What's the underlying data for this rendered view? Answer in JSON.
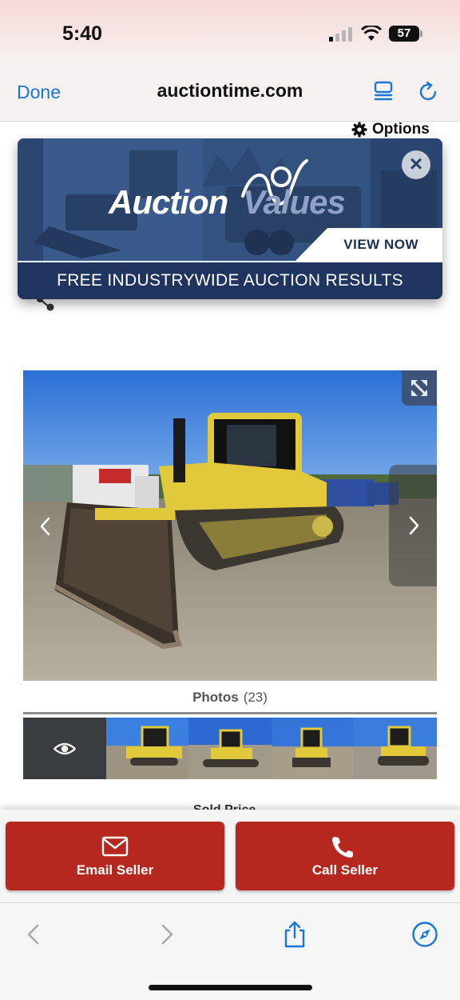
{
  "status_bar": {
    "time": "5:40",
    "battery": "57"
  },
  "browser": {
    "done_label": "Done",
    "host": "auctiontime.com"
  },
  "page": {
    "options_label": "Options",
    "ad": {
      "logo_part1": "Auction",
      "logo_part2": "Values",
      "cta": "VIEW NOW",
      "banner": "FREE INDUSTRYWIDE AUCTION RESULTS"
    },
    "photos": {
      "label": "Photos",
      "count": "(23)"
    },
    "peek_text": "Sold Price"
  },
  "actions": {
    "email_label": "Email Seller",
    "call_label": "Call Seller"
  },
  "colors": {
    "accent": "#1878d8",
    "cta": "#b5271f",
    "ad_navy": "#1f345e"
  },
  "icons": [
    "gear-icon",
    "close-icon",
    "expand-icon",
    "chevron-left-icon",
    "chevron-right-icon",
    "eye-icon",
    "mail-icon",
    "phone-icon",
    "back-icon",
    "forward-icon",
    "share-icon",
    "compass-icon",
    "reader-icon",
    "reload-icon"
  ]
}
